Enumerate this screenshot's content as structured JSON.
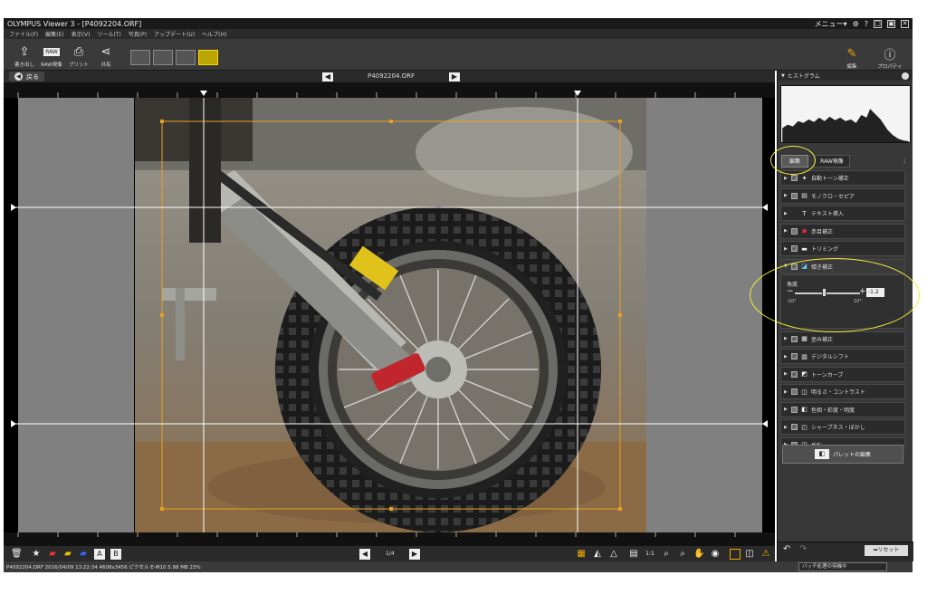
{
  "window": {
    "title": "OLYMPUS Viewer 3 - [P4092204.ORF]",
    "menu_label": "メニュー▾",
    "controls": [
      "⚙",
      "?",
      "▢",
      "▣",
      "✕"
    ]
  },
  "menubar": {
    "items": [
      "ファイル(F)",
      "編集(E)",
      "表示(V)",
      "ツール(T)",
      "写真(P)",
      "アップデート(U)",
      "ヘルプ(H)"
    ]
  },
  "toolbar": {
    "export_label": "書き出し",
    "raw_label": "RAW現像",
    "print_label": "プリント",
    "share_label": "共有",
    "edit_label": "編集",
    "properties_label": "プロパティ"
  },
  "navbar": {
    "back_label": "戻る",
    "filename": "P4092204.ORF"
  },
  "bottombar": {
    "page_indicator": "1/4"
  },
  "statusbar": {
    "info": "P4092204.ORF  2016/04/09 13:22:34  4608x3456 ピクセル  E-M10  5.98 MB  23%",
    "batch_status": "バッチ処理の待機中"
  },
  "panel": {
    "histogram_title": "ヒストグラム",
    "tabs": {
      "edit": "編集",
      "raw": "RAW現像"
    },
    "items": [
      {
        "label": "自動トーン補正",
        "checked": true,
        "icon": "auto-tone-icon",
        "glyph": "✦"
      },
      {
        "label": "モノクロ・セピア",
        "checked": false,
        "icon": "monochrome-icon",
        "glyph": "▤"
      },
      {
        "label": "テキスト挿入",
        "checked": false,
        "icon": "text-icon",
        "glyph": "T"
      },
      {
        "label": "赤目補正",
        "checked": false,
        "icon": "redeye-icon",
        "glyph": "◉"
      },
      {
        "label": "トリミング",
        "checked": true,
        "icon": "trim-icon",
        "glyph": "▬"
      },
      {
        "label": "傾き補正",
        "checked": true,
        "icon": "tilt-icon",
        "glyph": "◪"
      }
    ],
    "tilt": {
      "angle_label": "角度",
      "value": "-1.2",
      "min_label": "-10°",
      "max_label": "10°",
      "position": 0.44
    },
    "items2": [
      {
        "label": "歪み補正",
        "checked": true,
        "icon": "distortion-icon",
        "glyph": "▦"
      },
      {
        "label": "デジタルシフト",
        "checked": true,
        "icon": "digital-shift-icon",
        "glyph": "▥"
      },
      {
        "label": "トーンカーブ",
        "checked": true,
        "icon": "tone-curve-icon",
        "glyph": "◩"
      },
      {
        "label": "明るさ・コントラスト",
        "checked": false,
        "icon": "brightness-icon",
        "glyph": "◫"
      },
      {
        "label": "色相・彩度・明度",
        "checked": false,
        "icon": "hue-icon",
        "glyph": "◧"
      },
      {
        "label": "シャープネス・ぼかし",
        "checked": true,
        "icon": "sharpness-icon",
        "glyph": "◰"
      },
      {
        "label": "反転",
        "checked": false,
        "icon": "flip-icon",
        "glyph": "◳"
      }
    ],
    "palette_label": "パレットの編集",
    "reset_label": "➡リセット"
  },
  "colors": {
    "accent": "#f2a900",
    "highlight": "#f4eb3a",
    "crop": "#e8a020"
  }
}
